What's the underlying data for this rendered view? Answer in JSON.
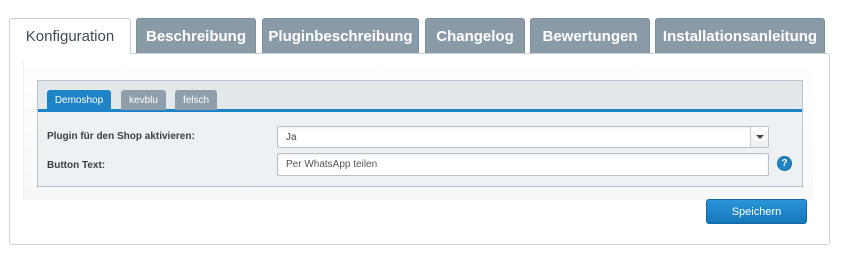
{
  "tabs": [
    {
      "label": "Konfiguration",
      "active": true
    },
    {
      "label": "Beschreibung",
      "active": false
    },
    {
      "label": "Pluginbeschreibung",
      "active": false
    },
    {
      "label": "Changelog",
      "active": false
    },
    {
      "label": "Bewertungen",
      "active": false
    },
    {
      "label": "Installationsanleitung",
      "active": false
    }
  ],
  "shop_tabs": [
    {
      "label": "Demoshop",
      "active": true
    },
    {
      "label": "kevblu",
      "active": false
    },
    {
      "label": "felsch",
      "active": false
    }
  ],
  "form": {
    "activate_label": "Plugin für den Shop aktivieren:",
    "activate_value": "Ja",
    "button_text_label": "Button Text:",
    "button_text_value": "Per WhatsApp teilen",
    "help_glyph": "?"
  },
  "actions": {
    "save_label": "Speichern"
  },
  "colors": {
    "accent": "#1f84c7",
    "inactive_tab": "#8a9ba8",
    "panel_bg": "#eef1f3"
  }
}
